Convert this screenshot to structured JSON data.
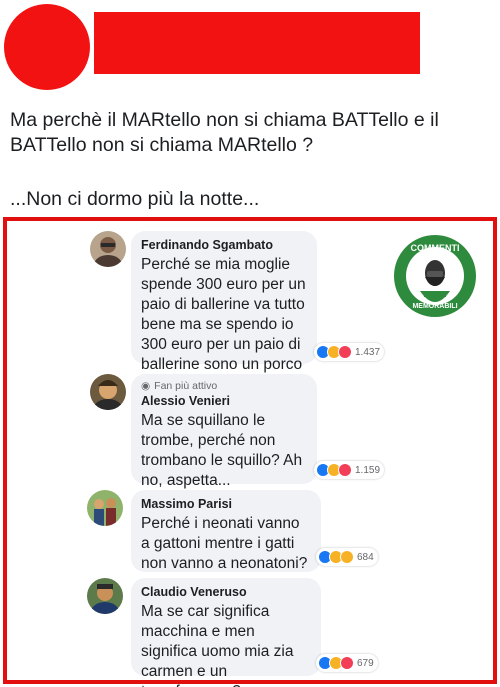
{
  "post": {
    "line1": "Ma perchè il MARtello non si chiama BATTello e il BATTello non si chiama MARtello ?",
    "line2": "...Non ci dormo più la notte..."
  },
  "logo": {
    "text_top": "COMMENTI",
    "text_bottom": "MEMORABILI"
  },
  "comments": [
    {
      "name": "Ferdinando Sgambato",
      "badge": "",
      "text": "Perché se mia moglie spende 300 euro per un paio di ballerine va tutto bene ma se spendo io 300 euro per un paio di ballerine sono un porco",
      "reactions": [
        "like",
        "haha",
        "love"
      ],
      "count": "1.437"
    },
    {
      "name": "Alessio Venieri",
      "badge": "Fan più attivo",
      "text": "Ma se squillano le trombe, perché non trombano le squillo? Ah no, aspetta...",
      "reactions": [
        "like",
        "haha",
        "love"
      ],
      "count": "1.159"
    },
    {
      "name": "Massimo Parisi",
      "badge": "",
      "text": "Perché i neonati vanno a gattoni mentre i gatti non vanno a neonatoni?",
      "reactions": [
        "like",
        "haha",
        "wow"
      ],
      "count": "684"
    },
    {
      "name": "Claudio Veneruso",
      "badge": "",
      "text": "Ma se car significa macchina e men significa uomo mia zia carmen e un transformers ?",
      "reactions": [
        "like",
        "haha",
        "love"
      ],
      "count": "679"
    }
  ],
  "colors": {
    "redact": "#f31212",
    "frame": "#e20f0f",
    "bubble": "#f0f2f5",
    "logo_green": "#2e8b3d"
  }
}
